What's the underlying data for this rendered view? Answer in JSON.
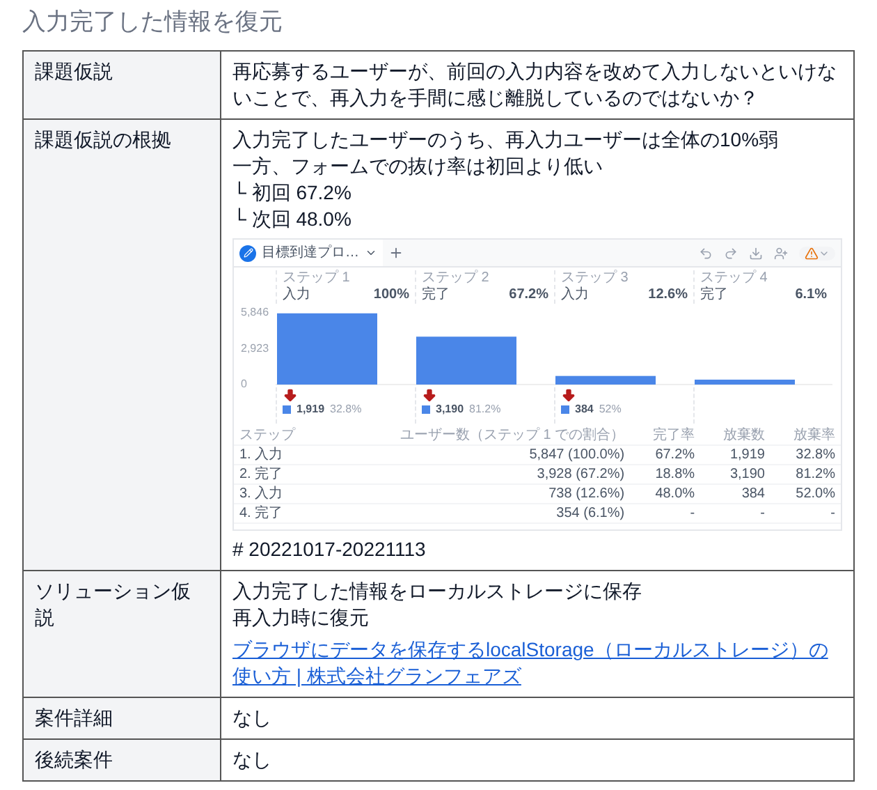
{
  "title": "入力完了した情報を復元",
  "rows": [
    {
      "label": "課題仮説",
      "blocks": [
        {
          "kind": "text",
          "lines": [
            "再応募するユーザーが、前回の入力内容を改めて入力しないといけないことで、再入力を手間に感じ離脱しているのではないか？"
          ]
        }
      ]
    },
    {
      "label": "課題仮説の根拠",
      "blocks": [
        {
          "kind": "text",
          "lines": [
            "入力完了したユーザーのうち、再入力ユーザーは全体の10%弱",
            "一方、フォームでの抜け率は初回より低い",
            "└ 初回 67.2%",
            "└ 次回 48.0%"
          ]
        },
        {
          "kind": "screenshot",
          "tab": "目標到達プロ…",
          "steps": [
            {
              "name": "入力",
              "percent": "100%",
              "drop_count": "1,919",
              "drop_rate": "32.8%"
            },
            {
              "name": "完了",
              "percent": "67.2%",
              "drop_count": "3,190",
              "drop_rate": "81.2%"
            },
            {
              "name": "入力",
              "percent": "12.6%",
              "drop_count": "384",
              "drop_rate": "52%"
            },
            {
              "name": "完了",
              "percent": "6.1%"
            }
          ],
          "chart_data": {
            "type": "bar",
            "categories": [
              "ステップ 1",
              "ステップ 2",
              "ステップ 3",
              "ステップ 4"
            ],
            "values": [
              5800,
              3900,
              700,
              400
            ],
            "ylim": [
              0,
              5900
            ],
            "yticks": [
              {
                "value": 0,
                "label": "0"
              },
              {
                "value": 2923,
                "label": "2,923"
              },
              {
                "value": 5846,
                "label": "5,846"
              }
            ]
          },
          "table": {
            "columns": [
              "ステップ",
              "ユーザー数（ステップ 1 での割合）",
              "完了率",
              "放棄数",
              "放棄率"
            ],
            "rows": [
              [
                "1. 入力",
                "5,847 (100.0%)",
                "67.2%",
                "1,919",
                "32.8%"
              ],
              [
                "2. 完了",
                "3,928 (67.2%)",
                "18.8%",
                "3,190",
                "81.2%"
              ],
              [
                "3. 入力",
                "738 (12.6%)",
                "48.0%",
                "384",
                "52.0%"
              ],
              [
                "4. 完了",
                "354 (6.1%)",
                "-",
                "-",
                "-"
              ]
            ]
          }
        },
        {
          "kind": "text",
          "lines": [
            "# 20221017-20221113"
          ]
        }
      ]
    },
    {
      "label": "ソリューション仮説",
      "blocks": [
        {
          "kind": "text",
          "lines": [
            "入力完了した情報をローカルストレージに保存",
            "再入力時に復元"
          ]
        },
        {
          "kind": "link",
          "text": "ブラウザにデータを保存するlocalStorage（ローカルストレージ）の使い方 | 株式会社グランフェアズ"
        }
      ]
    },
    {
      "label": "案件詳細",
      "blocks": [
        {
          "kind": "text",
          "lines": [
            "なし"
          ]
        }
      ]
    },
    {
      "label": "後続案件",
      "blocks": [
        {
          "kind": "text",
          "lines": [
            "なし"
          ]
        }
      ]
    }
  ]
}
